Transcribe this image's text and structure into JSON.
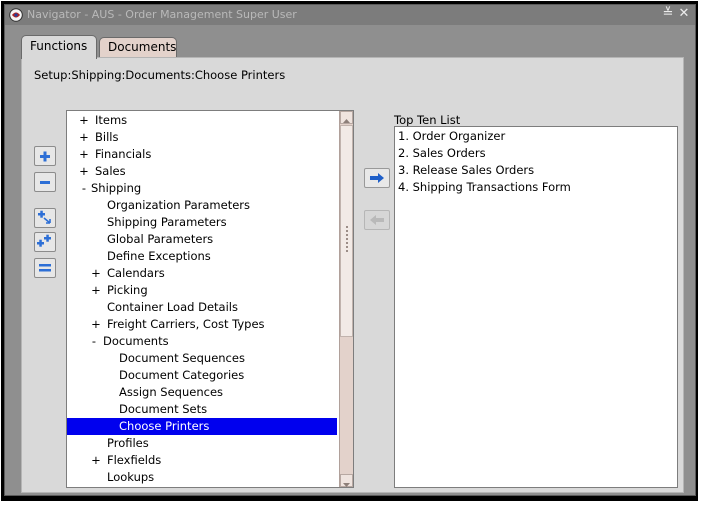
{
  "window": {
    "title": "Navigator - AUS - Order Management Super User",
    "minimize_glyph": "≚",
    "close_glyph": "✕"
  },
  "tabs": [
    {
      "label": "Functions",
      "active": true
    },
    {
      "label": "Documents",
      "active": false
    }
  ],
  "breadcrumb": "Setup:Shipping:Documents:Choose Printers",
  "side_buttons": [
    "expand-icon",
    "collapse-icon",
    "expand-branch-icon",
    "expand-all-icon",
    "collapse-all-icon"
  ],
  "tree": {
    "items": [
      {
        "toggle": "+",
        "label": "Items"
      },
      {
        "toggle": "+",
        "label": "Bills"
      },
      {
        "toggle": "+",
        "label": "Financials"
      },
      {
        "toggle": "+",
        "label": "Sales"
      },
      {
        "toggle": "-",
        "label": "Shipping"
      },
      {
        "toggle": "",
        "label": "Organization Parameters"
      },
      {
        "toggle": "",
        "label": "Shipping Parameters"
      },
      {
        "toggle": "",
        "label": "Global Parameters"
      },
      {
        "toggle": "",
        "label": "Define Exceptions"
      },
      {
        "toggle": "+",
        "label": "Calendars"
      },
      {
        "toggle": "+",
        "label": "Picking"
      },
      {
        "toggle": "",
        "label": "Container Load Details"
      },
      {
        "toggle": "+",
        "label": "Freight Carriers, Cost Types"
      },
      {
        "toggle": "-",
        "label": "Documents"
      },
      {
        "toggle": "",
        "label": "Document Sequences"
      },
      {
        "toggle": "",
        "label": "Document Categories"
      },
      {
        "toggle": "",
        "label": "Assign Sequences"
      },
      {
        "toggle": "",
        "label": "Document Sets"
      },
      {
        "toggle": "",
        "label": "Choose Printers",
        "selected": true
      },
      {
        "toggle": "",
        "label": "Profiles"
      },
      {
        "toggle": "+",
        "label": "Flexfields"
      },
      {
        "toggle": "",
        "label": "Lookups"
      }
    ]
  },
  "top_ten": {
    "label": "Top Ten List",
    "items": [
      "1. Order Organizer",
      "2. Sales Orders",
      "3. Release Sales Orders",
      "4. Shipping Transactions Form"
    ]
  },
  "colors": {
    "selection": "#0000ee",
    "accent_arrow": "#1f5fc8",
    "tab_inactive": "#e3d2cb"
  }
}
